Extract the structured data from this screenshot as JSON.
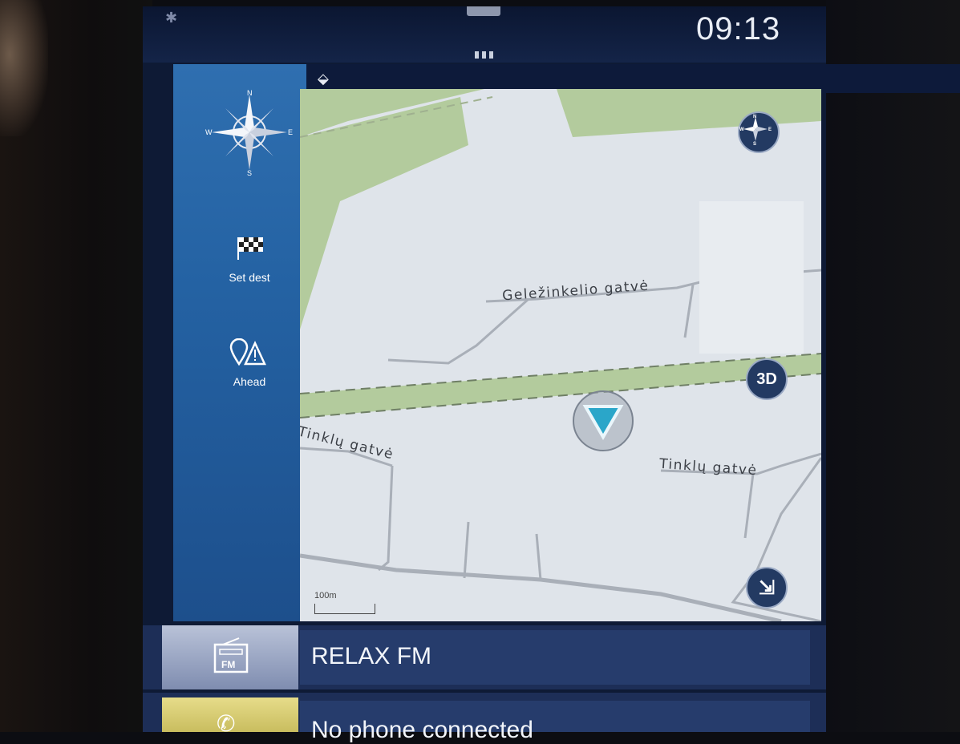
{
  "status_bar": {
    "time": "09:13",
    "bluetooth_icon": "bluetooth-icon"
  },
  "nav": {
    "items": [
      {
        "id": "compass",
        "icon": "compass-rose-icon",
        "label": "",
        "north": "N",
        "south": "S",
        "east": "E",
        "west": "W"
      },
      {
        "id": "set-dest",
        "icon": "checkered-flag-icon",
        "label": "Set dest"
      },
      {
        "id": "ahead",
        "icon": "pin-warning-icon",
        "label": "Ahead"
      }
    ]
  },
  "map": {
    "streets": [
      {
        "name": "Geležinkelio gatvė"
      },
      {
        "name": "Tinklų gatvė"
      },
      {
        "name": "Tinklų gatvė"
      }
    ],
    "scale_label": "100m",
    "buttons": {
      "compass": {
        "icon": "compass-icon",
        "n": "N",
        "s": "S",
        "e": "E",
        "w": "W"
      },
      "view_mode": "3D",
      "arrow": {
        "icon": "arrow-down-right-icon"
      }
    },
    "position_marker": "navigation-arrow-icon",
    "colors": {
      "land": "#dfe4ea",
      "park": "#b3cb9d",
      "road": "#a9afb8"
    }
  },
  "media": {
    "source_icon": "fm-radio-icon",
    "source_label": "FM",
    "station": "RELAX FM"
  },
  "phone": {
    "icon": "phone-icon",
    "status": "No phone connected"
  }
}
